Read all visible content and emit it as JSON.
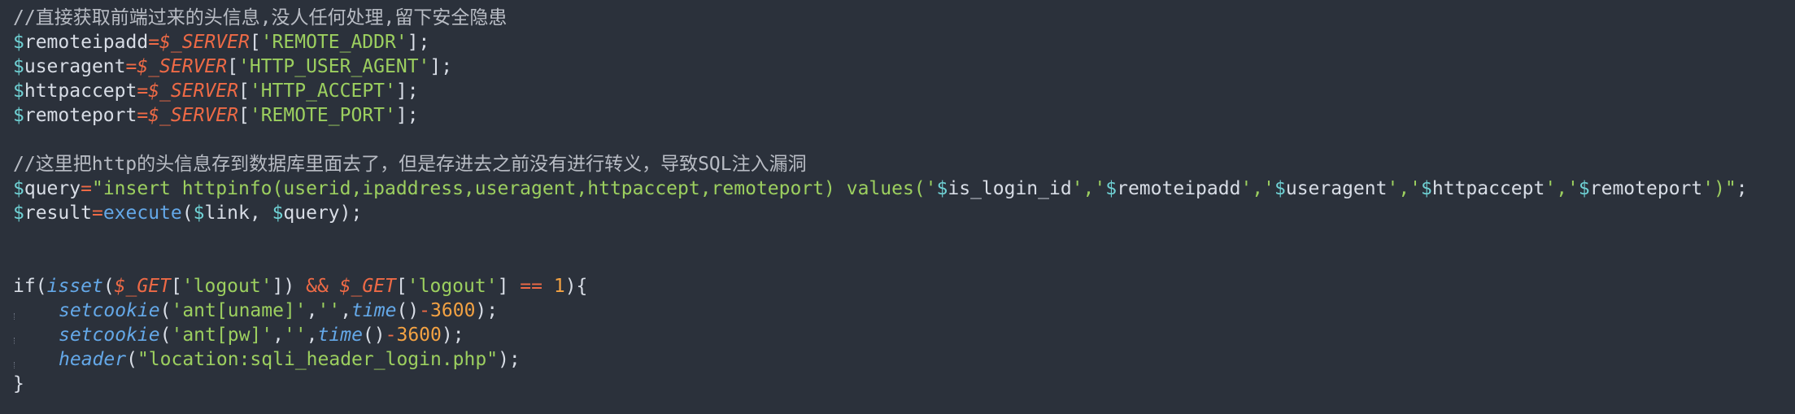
{
  "editor": {
    "colors": {
      "background": "#2b313b",
      "comment": "#b8bcc4",
      "variable": "#6fd1d4",
      "operator": "#ee6a46",
      "string": "#9ccf5f",
      "number": "#f3a243",
      "function": "#64a8e8",
      "default": "#d8dde6"
    },
    "lines": [
      {
        "indent": false,
        "tokens": [
          {
            "text": "//直接获取前端过来的头信息,没人任何处理,留下安全隐患",
            "kind": "comment"
          }
        ]
      },
      {
        "indent": false,
        "tokens": [
          {
            "text": "$",
            "kind": "var"
          },
          {
            "text": "remoteipadd",
            "kind": "default"
          },
          {
            "text": "=",
            "kind": "op"
          },
          {
            "text": "$_SERVER",
            "kind": "super"
          },
          {
            "text": "[",
            "kind": "default"
          },
          {
            "text": "'REMOTE_ADDR'",
            "kind": "str"
          },
          {
            "text": "];",
            "kind": "default"
          }
        ]
      },
      {
        "indent": false,
        "tokens": [
          {
            "text": "$",
            "kind": "var"
          },
          {
            "text": "useragent",
            "kind": "default"
          },
          {
            "text": "=",
            "kind": "op"
          },
          {
            "text": "$_SERVER",
            "kind": "super"
          },
          {
            "text": "[",
            "kind": "default"
          },
          {
            "text": "'HTTP_USER_AGENT'",
            "kind": "str"
          },
          {
            "text": "];",
            "kind": "default"
          }
        ]
      },
      {
        "indent": false,
        "tokens": [
          {
            "text": "$",
            "kind": "var"
          },
          {
            "text": "httpaccept",
            "kind": "default"
          },
          {
            "text": "=",
            "kind": "op"
          },
          {
            "text": "$_SERVER",
            "kind": "super"
          },
          {
            "text": "[",
            "kind": "default"
          },
          {
            "text": "'HTTP_ACCEPT'",
            "kind": "str"
          },
          {
            "text": "];",
            "kind": "default"
          }
        ]
      },
      {
        "indent": false,
        "tokens": [
          {
            "text": "$",
            "kind": "var"
          },
          {
            "text": "remoteport",
            "kind": "default"
          },
          {
            "text": "=",
            "kind": "op"
          },
          {
            "text": "$_SERVER",
            "kind": "super"
          },
          {
            "text": "[",
            "kind": "default"
          },
          {
            "text": "'REMOTE_PORT'",
            "kind": "str"
          },
          {
            "text": "];",
            "kind": "default"
          }
        ]
      },
      {
        "indent": false,
        "tokens": []
      },
      {
        "indent": false,
        "tokens": [
          {
            "text": "//这里把http的头信息存到数据库里面去了，但是存进去之前没有进行转义，导致SQL注入漏洞",
            "kind": "comment"
          }
        ]
      },
      {
        "indent": false,
        "tokens": [
          {
            "text": "$",
            "kind": "var"
          },
          {
            "text": "query",
            "kind": "default"
          },
          {
            "text": "=",
            "kind": "op"
          },
          {
            "text": "\"insert httpinfo(userid,ipaddress,useragent,httpaccept,remoteport) values('",
            "kind": "str"
          },
          {
            "text": "$",
            "kind": "var"
          },
          {
            "text": "is_login_id",
            "kind": "default"
          },
          {
            "text": "','",
            "kind": "str"
          },
          {
            "text": "$",
            "kind": "var"
          },
          {
            "text": "remoteipadd",
            "kind": "default"
          },
          {
            "text": "','",
            "kind": "str"
          },
          {
            "text": "$",
            "kind": "var"
          },
          {
            "text": "useragent",
            "kind": "default"
          },
          {
            "text": "','",
            "kind": "str"
          },
          {
            "text": "$",
            "kind": "var"
          },
          {
            "text": "httpaccept",
            "kind": "default"
          },
          {
            "text": "','",
            "kind": "str"
          },
          {
            "text": "$",
            "kind": "var"
          },
          {
            "text": "remoteport",
            "kind": "default"
          },
          {
            "text": "')\"",
            "kind": "str"
          },
          {
            "text": ";",
            "kind": "default"
          }
        ]
      },
      {
        "indent": false,
        "tokens": [
          {
            "text": "$",
            "kind": "var"
          },
          {
            "text": "result",
            "kind": "default"
          },
          {
            "text": "=",
            "kind": "op"
          },
          {
            "text": "execute",
            "kind": "funcplain"
          },
          {
            "text": "(",
            "kind": "default"
          },
          {
            "text": "$",
            "kind": "var"
          },
          {
            "text": "link, ",
            "kind": "default"
          },
          {
            "text": "$",
            "kind": "var"
          },
          {
            "text": "query);",
            "kind": "default"
          }
        ]
      },
      {
        "indent": false,
        "tokens": []
      },
      {
        "indent": false,
        "tokens": []
      },
      {
        "indent": false,
        "tokens": [
          {
            "text": "if",
            "kind": "keyword"
          },
          {
            "text": "(",
            "kind": "default"
          },
          {
            "text": "isset",
            "kind": "func"
          },
          {
            "text": "(",
            "kind": "default"
          },
          {
            "text": "$_GET",
            "kind": "super"
          },
          {
            "text": "[",
            "kind": "default"
          },
          {
            "text": "'logout'",
            "kind": "str"
          },
          {
            "text": "]) ",
            "kind": "default"
          },
          {
            "text": "&&",
            "kind": "op"
          },
          {
            "text": " ",
            "kind": "default"
          },
          {
            "text": "$_GET",
            "kind": "super"
          },
          {
            "text": "[",
            "kind": "default"
          },
          {
            "text": "'logout'",
            "kind": "str"
          },
          {
            "text": "] ",
            "kind": "default"
          },
          {
            "text": "==",
            "kind": "op"
          },
          {
            "text": " ",
            "kind": "default"
          },
          {
            "text": "1",
            "kind": "num"
          },
          {
            "text": "){",
            "kind": "default"
          }
        ]
      },
      {
        "indent": true,
        "tokens": [
          {
            "text": "setcookie",
            "kind": "func"
          },
          {
            "text": "(",
            "kind": "default"
          },
          {
            "text": "'ant[uname]'",
            "kind": "str"
          },
          {
            "text": ",",
            "kind": "default"
          },
          {
            "text": "''",
            "kind": "str"
          },
          {
            "text": ",",
            "kind": "default"
          },
          {
            "text": "time",
            "kind": "func"
          },
          {
            "text": "()",
            "kind": "default"
          },
          {
            "text": "-",
            "kind": "op"
          },
          {
            "text": "3600",
            "kind": "num"
          },
          {
            "text": ");",
            "kind": "default"
          }
        ]
      },
      {
        "indent": true,
        "tokens": [
          {
            "text": "setcookie",
            "kind": "func"
          },
          {
            "text": "(",
            "kind": "default"
          },
          {
            "text": "'ant[pw]'",
            "kind": "str"
          },
          {
            "text": ",",
            "kind": "default"
          },
          {
            "text": "''",
            "kind": "str"
          },
          {
            "text": ",",
            "kind": "default"
          },
          {
            "text": "time",
            "kind": "func"
          },
          {
            "text": "()",
            "kind": "default"
          },
          {
            "text": "-",
            "kind": "op"
          },
          {
            "text": "3600",
            "kind": "num"
          },
          {
            "text": ");",
            "kind": "default"
          }
        ]
      },
      {
        "indent": true,
        "tokens": [
          {
            "text": "header",
            "kind": "func"
          },
          {
            "text": "(",
            "kind": "default"
          },
          {
            "text": "\"location:sqli_header_login.php\"",
            "kind": "str"
          },
          {
            "text": ");",
            "kind": "default"
          }
        ]
      },
      {
        "indent": false,
        "tokens": [
          {
            "text": "}",
            "kind": "default"
          }
        ]
      }
    ]
  }
}
